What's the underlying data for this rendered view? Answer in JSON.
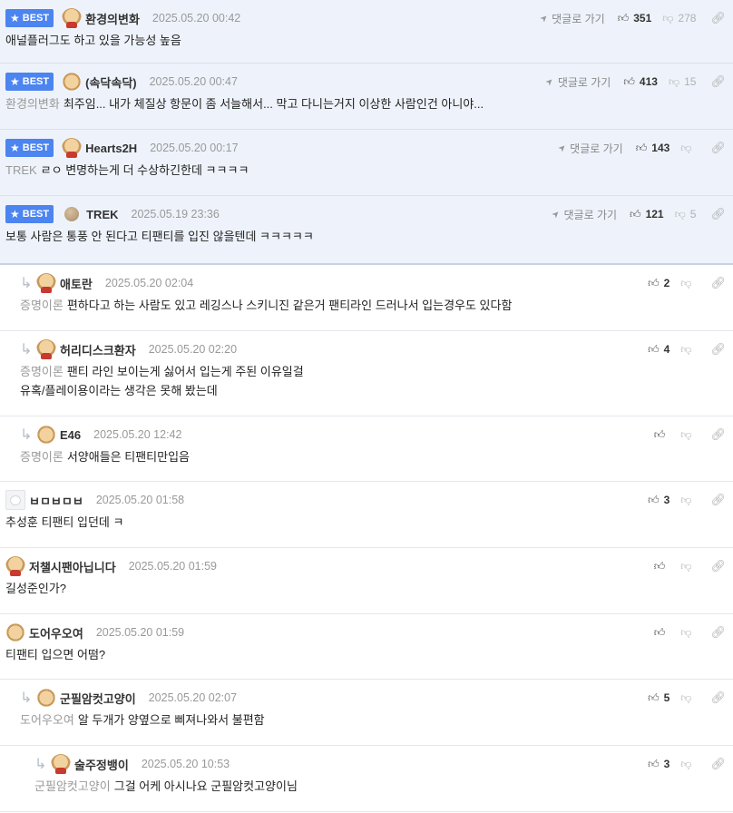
{
  "ui": {
    "best_label": "BEST",
    "goto_label": "댓글로 가기"
  },
  "comments": [
    {
      "best": true,
      "indent": 0,
      "avatar": "dog",
      "nick": "환경의변화",
      "date": "2025.05.20 00:42",
      "goto": true,
      "up": "351",
      "down": "278",
      "mention": "",
      "lines": [
        "애널플러그도 하고 있을 가능성 높음"
      ]
    },
    {
      "best": true,
      "indent": 0,
      "avatar": "plain",
      "nick": "(속닥속닥)",
      "date": "2025.05.20 00:47",
      "goto": true,
      "up": "413",
      "down": "15",
      "mention": "환경의변화",
      "lines": [
        "최주임... 내가 체질상 항문이 좀 서늘해서... 막고 다니는거지 이상한 사람인건 아니야..."
      ]
    },
    {
      "best": true,
      "indent": 0,
      "avatar": "dog",
      "nick": "Hearts2H",
      "date": "2025.05.20 00:17",
      "goto": true,
      "up": "143",
      "down": "",
      "mention": "TREK",
      "lines": [
        "ㄹㅇ 변명하는게 더 수상하긴한데 ㅋㅋㅋㅋ"
      ]
    },
    {
      "best": true,
      "last": true,
      "indent": 0,
      "avatar": "ball",
      "nick": "TREK",
      "date": "2025.05.19 23:36",
      "goto": true,
      "up": "121",
      "down": "5",
      "mention": "",
      "lines": [
        "보통 사람은 통풍 안 된다고 티팬티를 입진 않을텐데 ㅋㅋㅋㅋㅋ"
      ]
    },
    {
      "best": false,
      "indent": 1,
      "avatar": "dog",
      "nick": "애토란",
      "date": "2025.05.20 02:04",
      "goto": false,
      "up": "2",
      "down": "",
      "mention": "증명이론",
      "lines": [
        "편하다고 하는 사람도 있고 레깅스나 스키니진 같은거 팬티라인 드러나서 입는경우도 있다함"
      ]
    },
    {
      "best": false,
      "indent": 1,
      "avatar": "dog",
      "nick": "허리디스크환자",
      "date": "2025.05.20 02:20",
      "goto": false,
      "up": "4",
      "down": "",
      "mention": "증명이론",
      "lines": [
        "팬티 라인 보이는게 싫어서 입는게 주된 이유일걸",
        "유혹/플레이용이라는 생각은 못해 봤는데"
      ]
    },
    {
      "best": false,
      "indent": 1,
      "avatar": "plain",
      "nick": "E46",
      "date": "2025.05.20 12:42",
      "goto": false,
      "up": "",
      "down": "",
      "mention": "증명이론",
      "lines": [
        "서양애들은 티팬티만입음"
      ]
    },
    {
      "best": false,
      "indent": 0,
      "avatar": "white",
      "nick": "ㅂㅁㅂㅁㅂ",
      "date": "2025.05.20 01:58",
      "goto": false,
      "up": "3",
      "down": "",
      "mention": "",
      "lines": [
        "추성훈 티팬티 입던데 ㅋ"
      ]
    },
    {
      "best": false,
      "indent": 0,
      "avatar": "dog",
      "nick": "저챌시팬아닙니다",
      "date": "2025.05.20 01:59",
      "goto": false,
      "up": "",
      "down": "",
      "mention": "",
      "lines": [
        "길성준인가?"
      ]
    },
    {
      "best": false,
      "indent": 0,
      "avatar": "plain",
      "nick": "도어우오여",
      "date": "2025.05.20 01:59",
      "goto": false,
      "up": "",
      "down": "",
      "mention": "",
      "lines": [
        "티팬티 입으면 어떰?"
      ]
    },
    {
      "best": false,
      "indent": 1,
      "avatar": "plain",
      "nick": "군필암컷고양이",
      "date": "2025.05.20 02:07",
      "goto": false,
      "up": "5",
      "down": "",
      "mention": "도어우오여",
      "lines": [
        "알 두개가 양옆으로 삐져나와서 불편함"
      ]
    },
    {
      "best": false,
      "indent": 2,
      "avatar": "dog",
      "nick": "술주정뱅이",
      "date": "2025.05.20 10:53",
      "goto": false,
      "up": "3",
      "down": "",
      "mention": "군필암컷고양이",
      "lines": [
        "그걸 어케 아시나요 군필암컷고양이님"
      ]
    }
  ]
}
